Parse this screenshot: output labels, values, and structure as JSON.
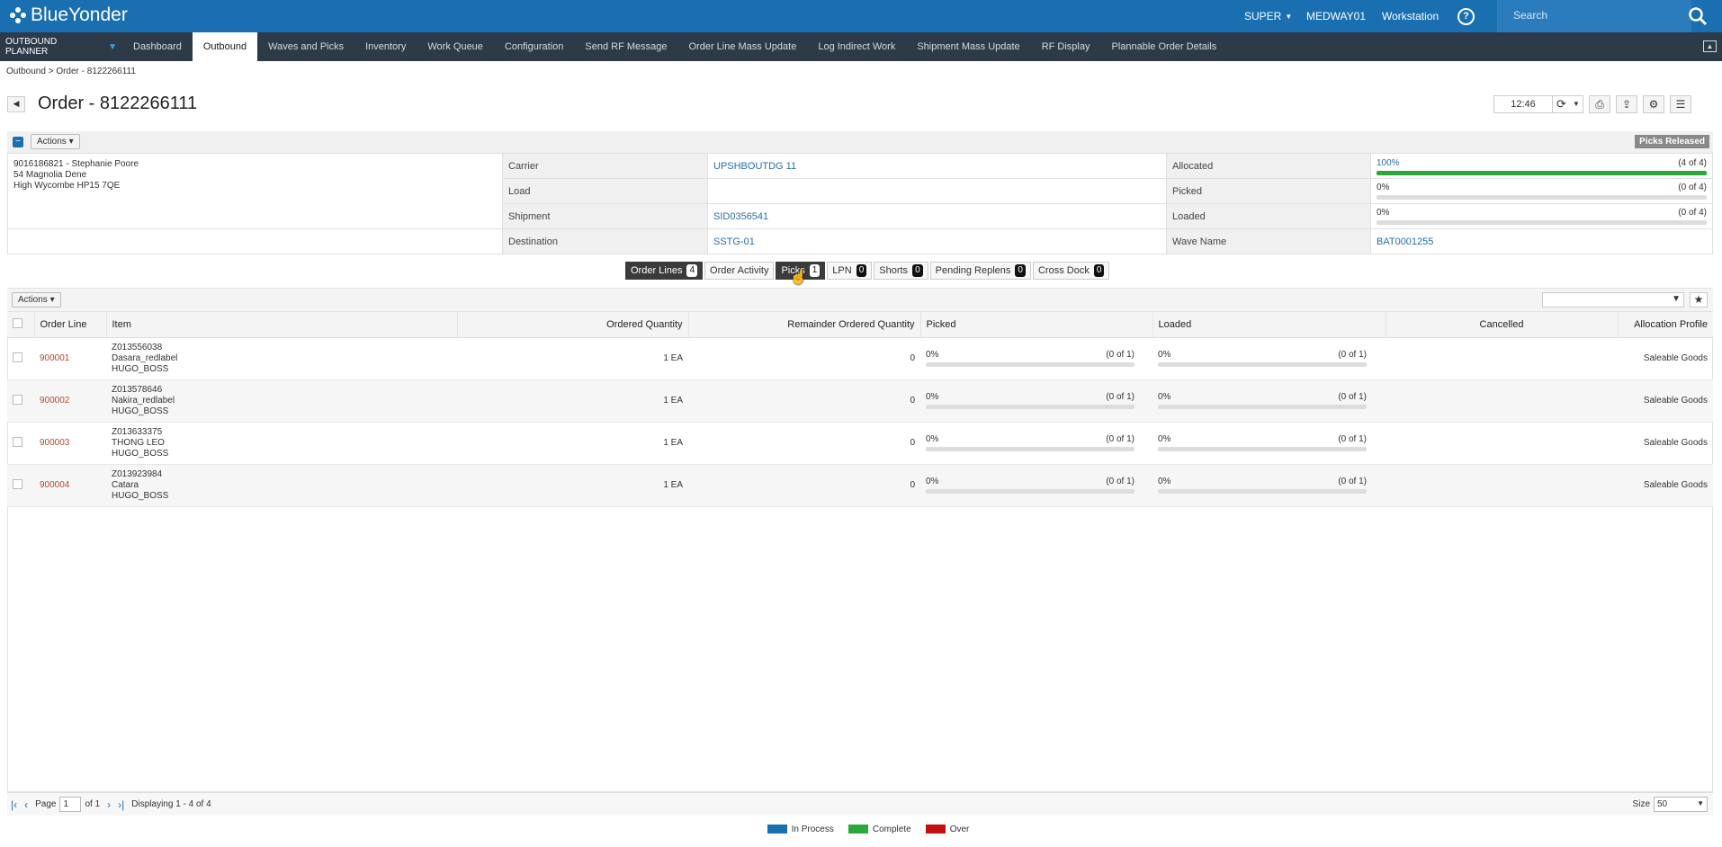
{
  "app": {
    "brand": "BlueYonder",
    "user": "SUPER",
    "warehouse": "MEDWAY01",
    "workstation": "Workstation",
    "search_placeholder": "Search"
  },
  "menu": {
    "planner": "OUTBOUND PLANNER",
    "tabs": [
      "Dashboard",
      "Outbound",
      "Waves and Picks",
      "Inventory",
      "Work Queue",
      "Configuration",
      "Send RF Message",
      "Order Line Mass Update",
      "Log Indirect Work",
      "Shipment Mass Update",
      "RF Display",
      "Plannable Order Details"
    ],
    "active": "Outbound"
  },
  "breadcrumb": "Outbound  >  Order - 8122266111",
  "page": {
    "title": "Order - 8122266111",
    "time": "12:46"
  },
  "panel": {
    "actions": "Actions",
    "status": "Picks Released"
  },
  "address": {
    "line1": "9016186821 - Stephanie Poore",
    "line2": "54 Magnolia Dene",
    "line3": "High Wycombe HP15 7QE"
  },
  "info": {
    "carrier_label": "Carrier",
    "carrier": "UPSHBOUTDG 11",
    "load_label": "Load",
    "load": "",
    "shipment_label": "Shipment",
    "shipment": "SID0356541",
    "destination_label": "Destination",
    "destination": "SSTG-01",
    "allocated_label": "Allocated",
    "allocated_pct": "100%",
    "allocated_count": "(4 of 4)",
    "allocated_fill": 100,
    "picked_label": "Picked",
    "picked_pct": "0%",
    "picked_count": "(0 of 4)",
    "picked_fill": 0,
    "loaded_label": "Loaded",
    "loaded_pct": "0%",
    "loaded_count": "(0 of 4)",
    "loaded_fill": 0,
    "wave_label": "Wave Name",
    "wave": "BAT0001255"
  },
  "subtabs": [
    {
      "label": "Order Lines",
      "count": "4"
    },
    {
      "label": "Order Activity",
      "count": ""
    },
    {
      "label": "Picks",
      "count": "1"
    },
    {
      "label": "LPN",
      "count": "0"
    },
    {
      "label": "Shorts",
      "count": "0"
    },
    {
      "label": "Pending Replens",
      "count": "0"
    },
    {
      "label": "Cross Dock",
      "count": "0"
    }
  ],
  "grid": {
    "actions": "Actions",
    "headers": {
      "order_line": "Order Line",
      "item": "Item",
      "ordered": "Ordered Quantity",
      "remainder": "Remainder Ordered Quantity",
      "picked": "Picked",
      "loaded": "Loaded",
      "cancelled": "Cancelled",
      "profile": "Allocation Profile"
    },
    "rows": [
      {
        "line": "900001",
        "item1": "Z013556038",
        "item2": "Dasara_redlabel",
        "item3": "HUGO_BOSS",
        "ordered": "1 EA",
        "remainder": "0",
        "picked_pct": "0%",
        "picked_count": "(0 of 1)",
        "loaded_pct": "0%",
        "loaded_count": "(0 of 1)",
        "profile": "Saleable Goods"
      },
      {
        "line": "900002",
        "item1": "Z013578646",
        "item2": "Nakira_redlabel",
        "item3": "HUGO_BOSS",
        "ordered": "1 EA",
        "remainder": "0",
        "picked_pct": "0%",
        "picked_count": "(0 of 1)",
        "loaded_pct": "0%",
        "loaded_count": "(0 of 1)",
        "profile": "Saleable Goods"
      },
      {
        "line": "900003",
        "item1": "Z013633375",
        "item2": "THONG LEO",
        "item3": "HUGO_BOSS",
        "ordered": "1 EA",
        "remainder": "0",
        "picked_pct": "0%",
        "picked_count": "(0 of 1)",
        "loaded_pct": "0%",
        "loaded_count": "(0 of 1)",
        "profile": "Saleable Goods"
      },
      {
        "line": "900004",
        "item1": "Z013923984",
        "item2": "Catara",
        "item3": "HUGO_BOSS",
        "ordered": "1 EA",
        "remainder": "0",
        "picked_pct": "0%",
        "picked_count": "(0 of 1)",
        "loaded_pct": "0%",
        "loaded_count": "(0 of 1)",
        "profile": "Saleable Goods"
      }
    ]
  },
  "pager": {
    "page_label": "Page",
    "page": "1",
    "of": "of 1",
    "displaying": "Displaying 1 - 4 of 4",
    "size_label": "Size",
    "size": "50"
  },
  "legend": [
    {
      "label": "In Process",
      "color": "#1a6fb0"
    },
    {
      "label": "Complete",
      "color": "#2aa83a"
    },
    {
      "label": "Over",
      "color": "#c01010"
    }
  ]
}
